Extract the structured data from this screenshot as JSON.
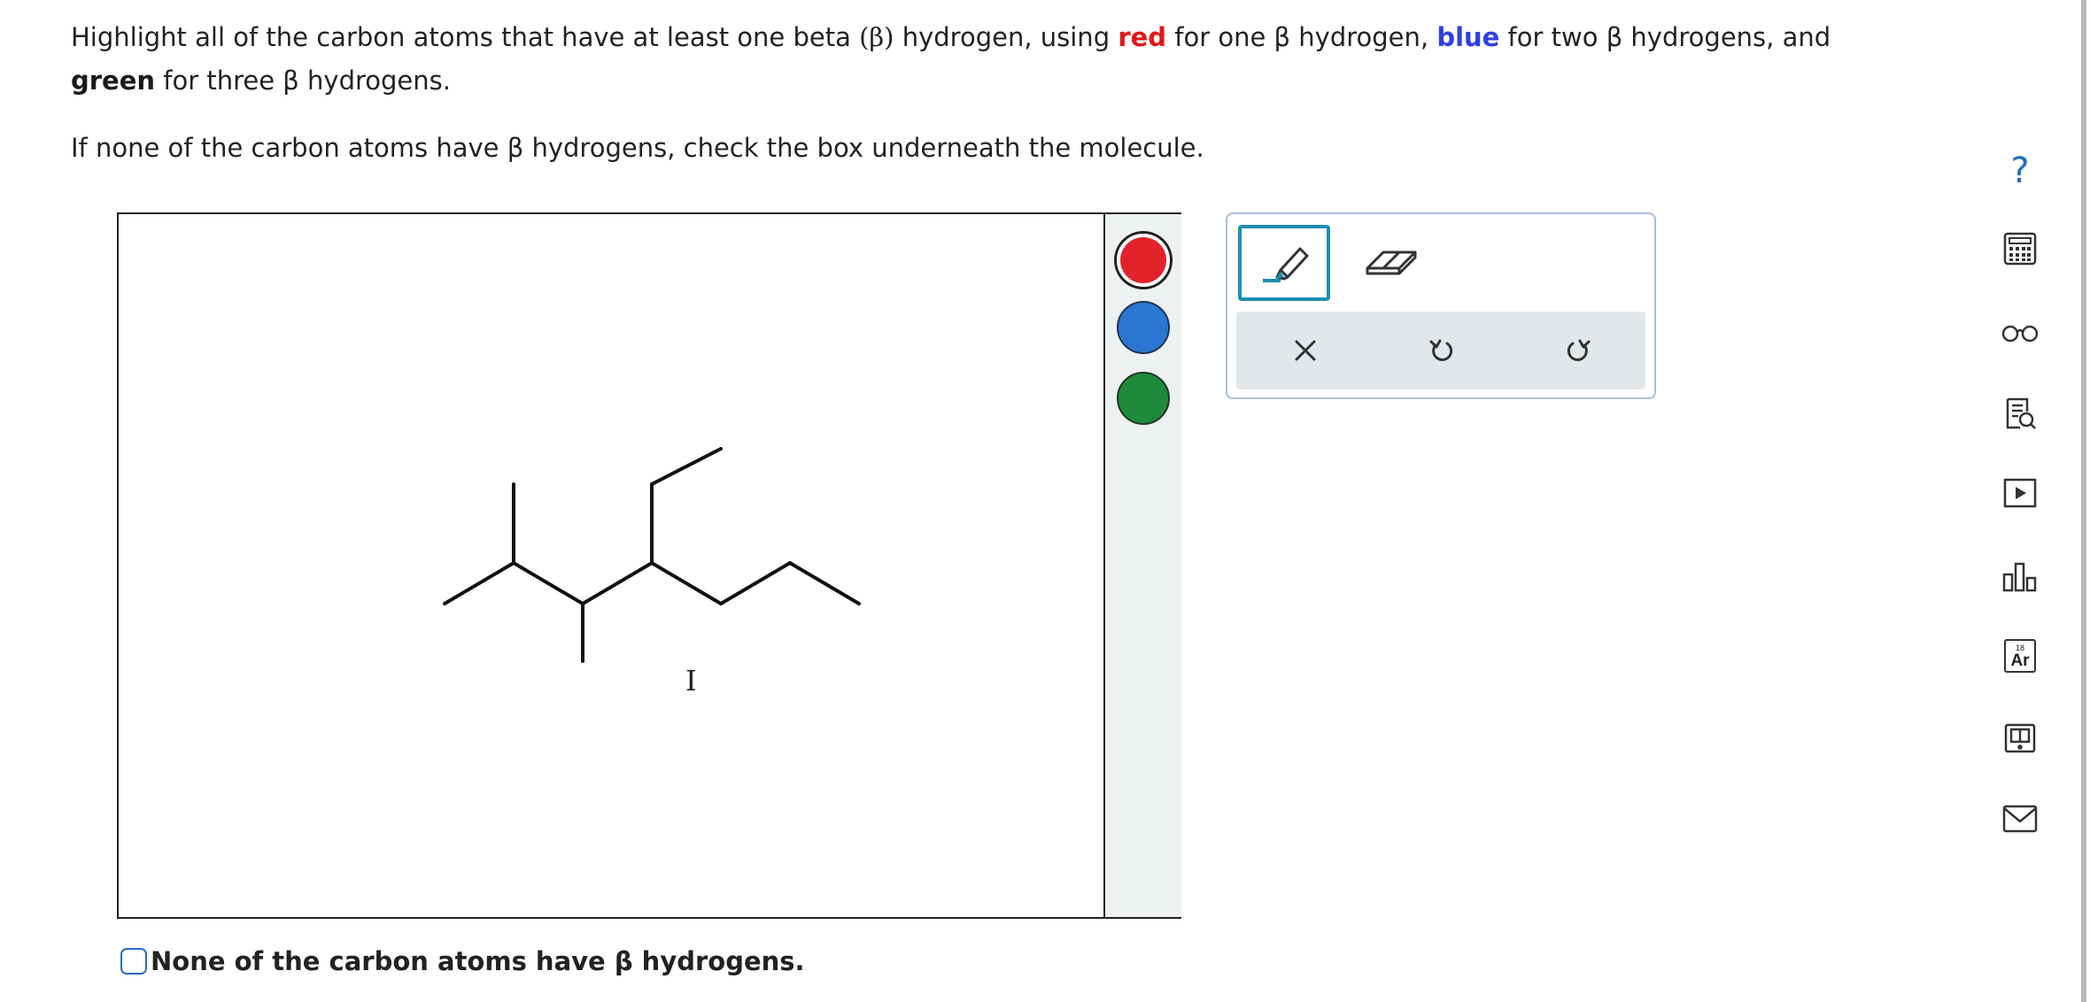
{
  "prompt": {
    "line1_a": "Highlight all of the carbon atoms that have at least one beta ",
    "beta_paren": "(β)",
    "line1_b": " hydrogen, using ",
    "red_word": "red",
    "line1_c": " for one β hydrogen, ",
    "blue_word": "blue",
    "line1_d": " for two β hydrogens, and ",
    "green_word": "green",
    "line1_e": " for three β hydrogens.",
    "line2": "If none of the carbon atoms have β hydrogens, check the box underneath the molecule."
  },
  "molecule": {
    "atom_label": "I"
  },
  "palette": {
    "colors": [
      "#e3232b",
      "#2a76d2",
      "#1f8a3a"
    ],
    "selected": "red"
  },
  "toolbar": {
    "tools": [
      "highlighter-pen",
      "eraser"
    ],
    "selected_tool": "highlighter-pen",
    "actions": [
      "clear",
      "undo",
      "redo"
    ]
  },
  "checkbox": {
    "label": "None of the carbon atoms have β hydrogens.",
    "checked": false
  },
  "sidebar": {
    "icons": [
      "help-icon",
      "calculator-icon",
      "glasses-icon",
      "notes-icon",
      "video-icon",
      "chart-icon",
      "periodic-table-icon",
      "textbook-icon",
      "mail-icon"
    ],
    "periodic_number": "18",
    "periodic_symbol": "Ar",
    "help_glyph": "?"
  }
}
